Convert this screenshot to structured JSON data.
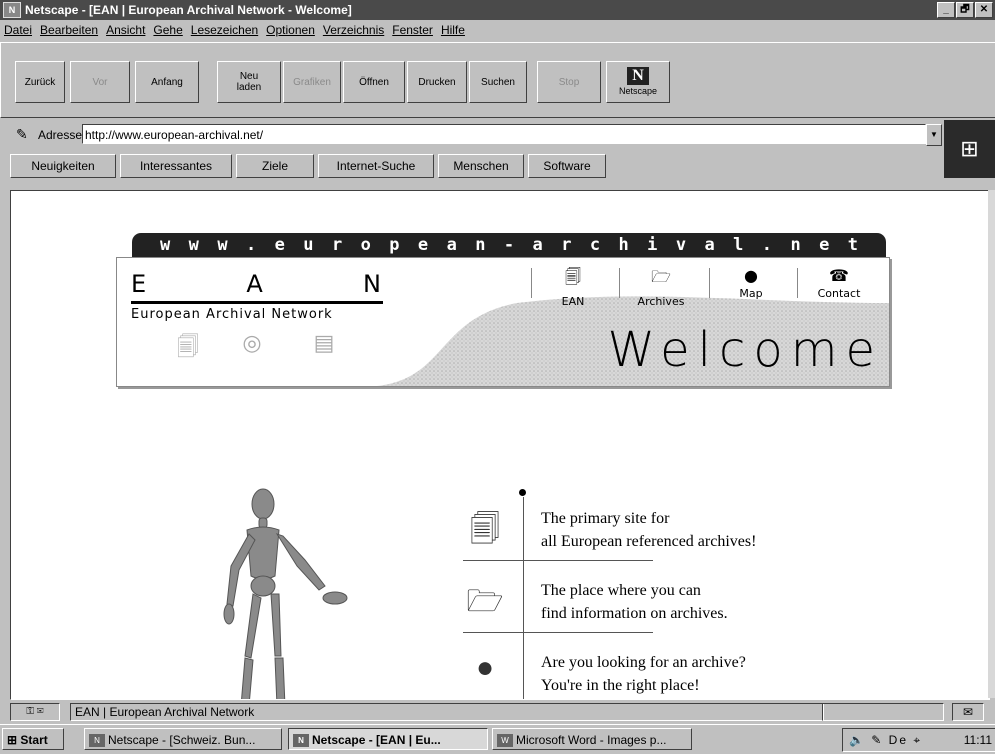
{
  "window": {
    "title": "Netscape - [EAN | European Archival Network - Welcome]",
    "controls": [
      "_",
      "🗗",
      "✕"
    ]
  },
  "menu": [
    "Datei",
    "Bearbeiten",
    "Ansicht",
    "Gehe",
    "Lesezeichen",
    "Optionen",
    "Verzeichnis",
    "Fenster",
    "Hilfe"
  ],
  "toolbar": {
    "back": "Zurück",
    "forward": "Vor",
    "home": "Anfang",
    "reload_line1": "Neu",
    "reload_line2": "laden",
    "images": "Grafiken",
    "open": "Öffnen",
    "print": "Drucken",
    "find": "Suchen",
    "stop": "Stop",
    "netscape": "Netscape"
  },
  "location": {
    "label": "Adresse:",
    "url": "http://www.european-archival.net/"
  },
  "directory_buttons": [
    "Neuigkeiten",
    "Interessantes",
    "Ziele",
    "Internet-Suche",
    "Menschen",
    "Software"
  ],
  "page": {
    "banner_url_chars": [
      "w",
      "w",
      "w",
      ".",
      "e",
      "u",
      "r",
      "o",
      "p",
      "e",
      "a",
      "n",
      "-",
      "a",
      "r",
      "c",
      "h",
      "i",
      "v",
      "a",
      "l",
      ".",
      "n",
      "e",
      "t"
    ],
    "logo_letters": [
      "E",
      "A",
      "N"
    ],
    "logo_subtitle": "European Archival Network",
    "welcome": "Welcome",
    "nav": [
      {
        "label": "EAN",
        "icon": "documents-icon"
      },
      {
        "label": "Archives",
        "icon": "folder-icon"
      },
      {
        "label": "Map",
        "icon": "globe-icon"
      },
      {
        "label": "Contact",
        "icon": "phone-icon"
      }
    ],
    "info_rows": [
      {
        "line1": "The primary site for",
        "line2": "all European referenced archives!",
        "icon": "documents-icon"
      },
      {
        "line1": "The place where you can",
        "line2": "find information on archives.",
        "icon": "folder-icon"
      },
      {
        "line1": "Are you looking for an archive?",
        "line2": "You're in the right place!",
        "icon": "globe-icon"
      }
    ]
  },
  "status": {
    "text": "EAN | European Archival Network"
  },
  "taskbar": {
    "start": "Start",
    "tasks": [
      {
        "label": "Netscape - [Schweiz. Bun...",
        "active": false
      },
      {
        "label": "Netscape - [EAN | Eu...",
        "active": true
      },
      {
        "label": "Microsoft Word - Images p...",
        "active": false
      }
    ],
    "tray_lang": "De",
    "clock": "11:11"
  }
}
